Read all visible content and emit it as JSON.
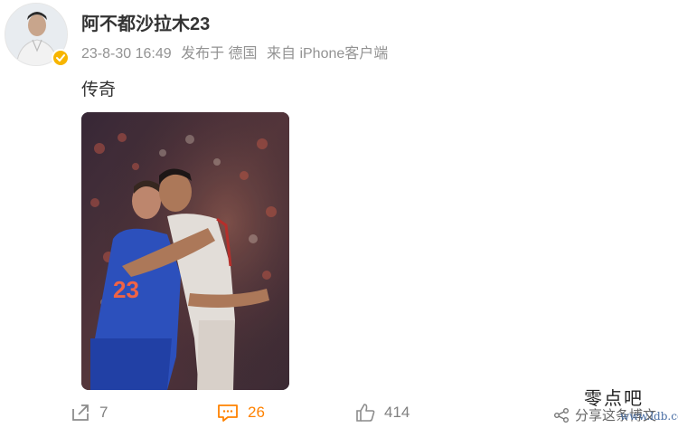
{
  "post": {
    "username": "阿不都沙拉木23",
    "time": "23-8-30 16:49",
    "location": "发布于 德国",
    "source": "来自 iPhone客户端",
    "text": "传奇"
  },
  "actions": {
    "share_count": "7",
    "comment_count": "26",
    "like_count": "414"
  },
  "watermark": {
    "title": "零点吧",
    "caption": "分享这条博文",
    "site": "www.ldb.cc"
  },
  "colors": {
    "accent": "#ff8200",
    "verified_badge": "#f7b500",
    "meta_text": "#939393"
  },
  "icons": {
    "share": "share-icon",
    "comment": "comment-icon",
    "like": "like-icon",
    "verified": "verified-badge-icon"
  }
}
